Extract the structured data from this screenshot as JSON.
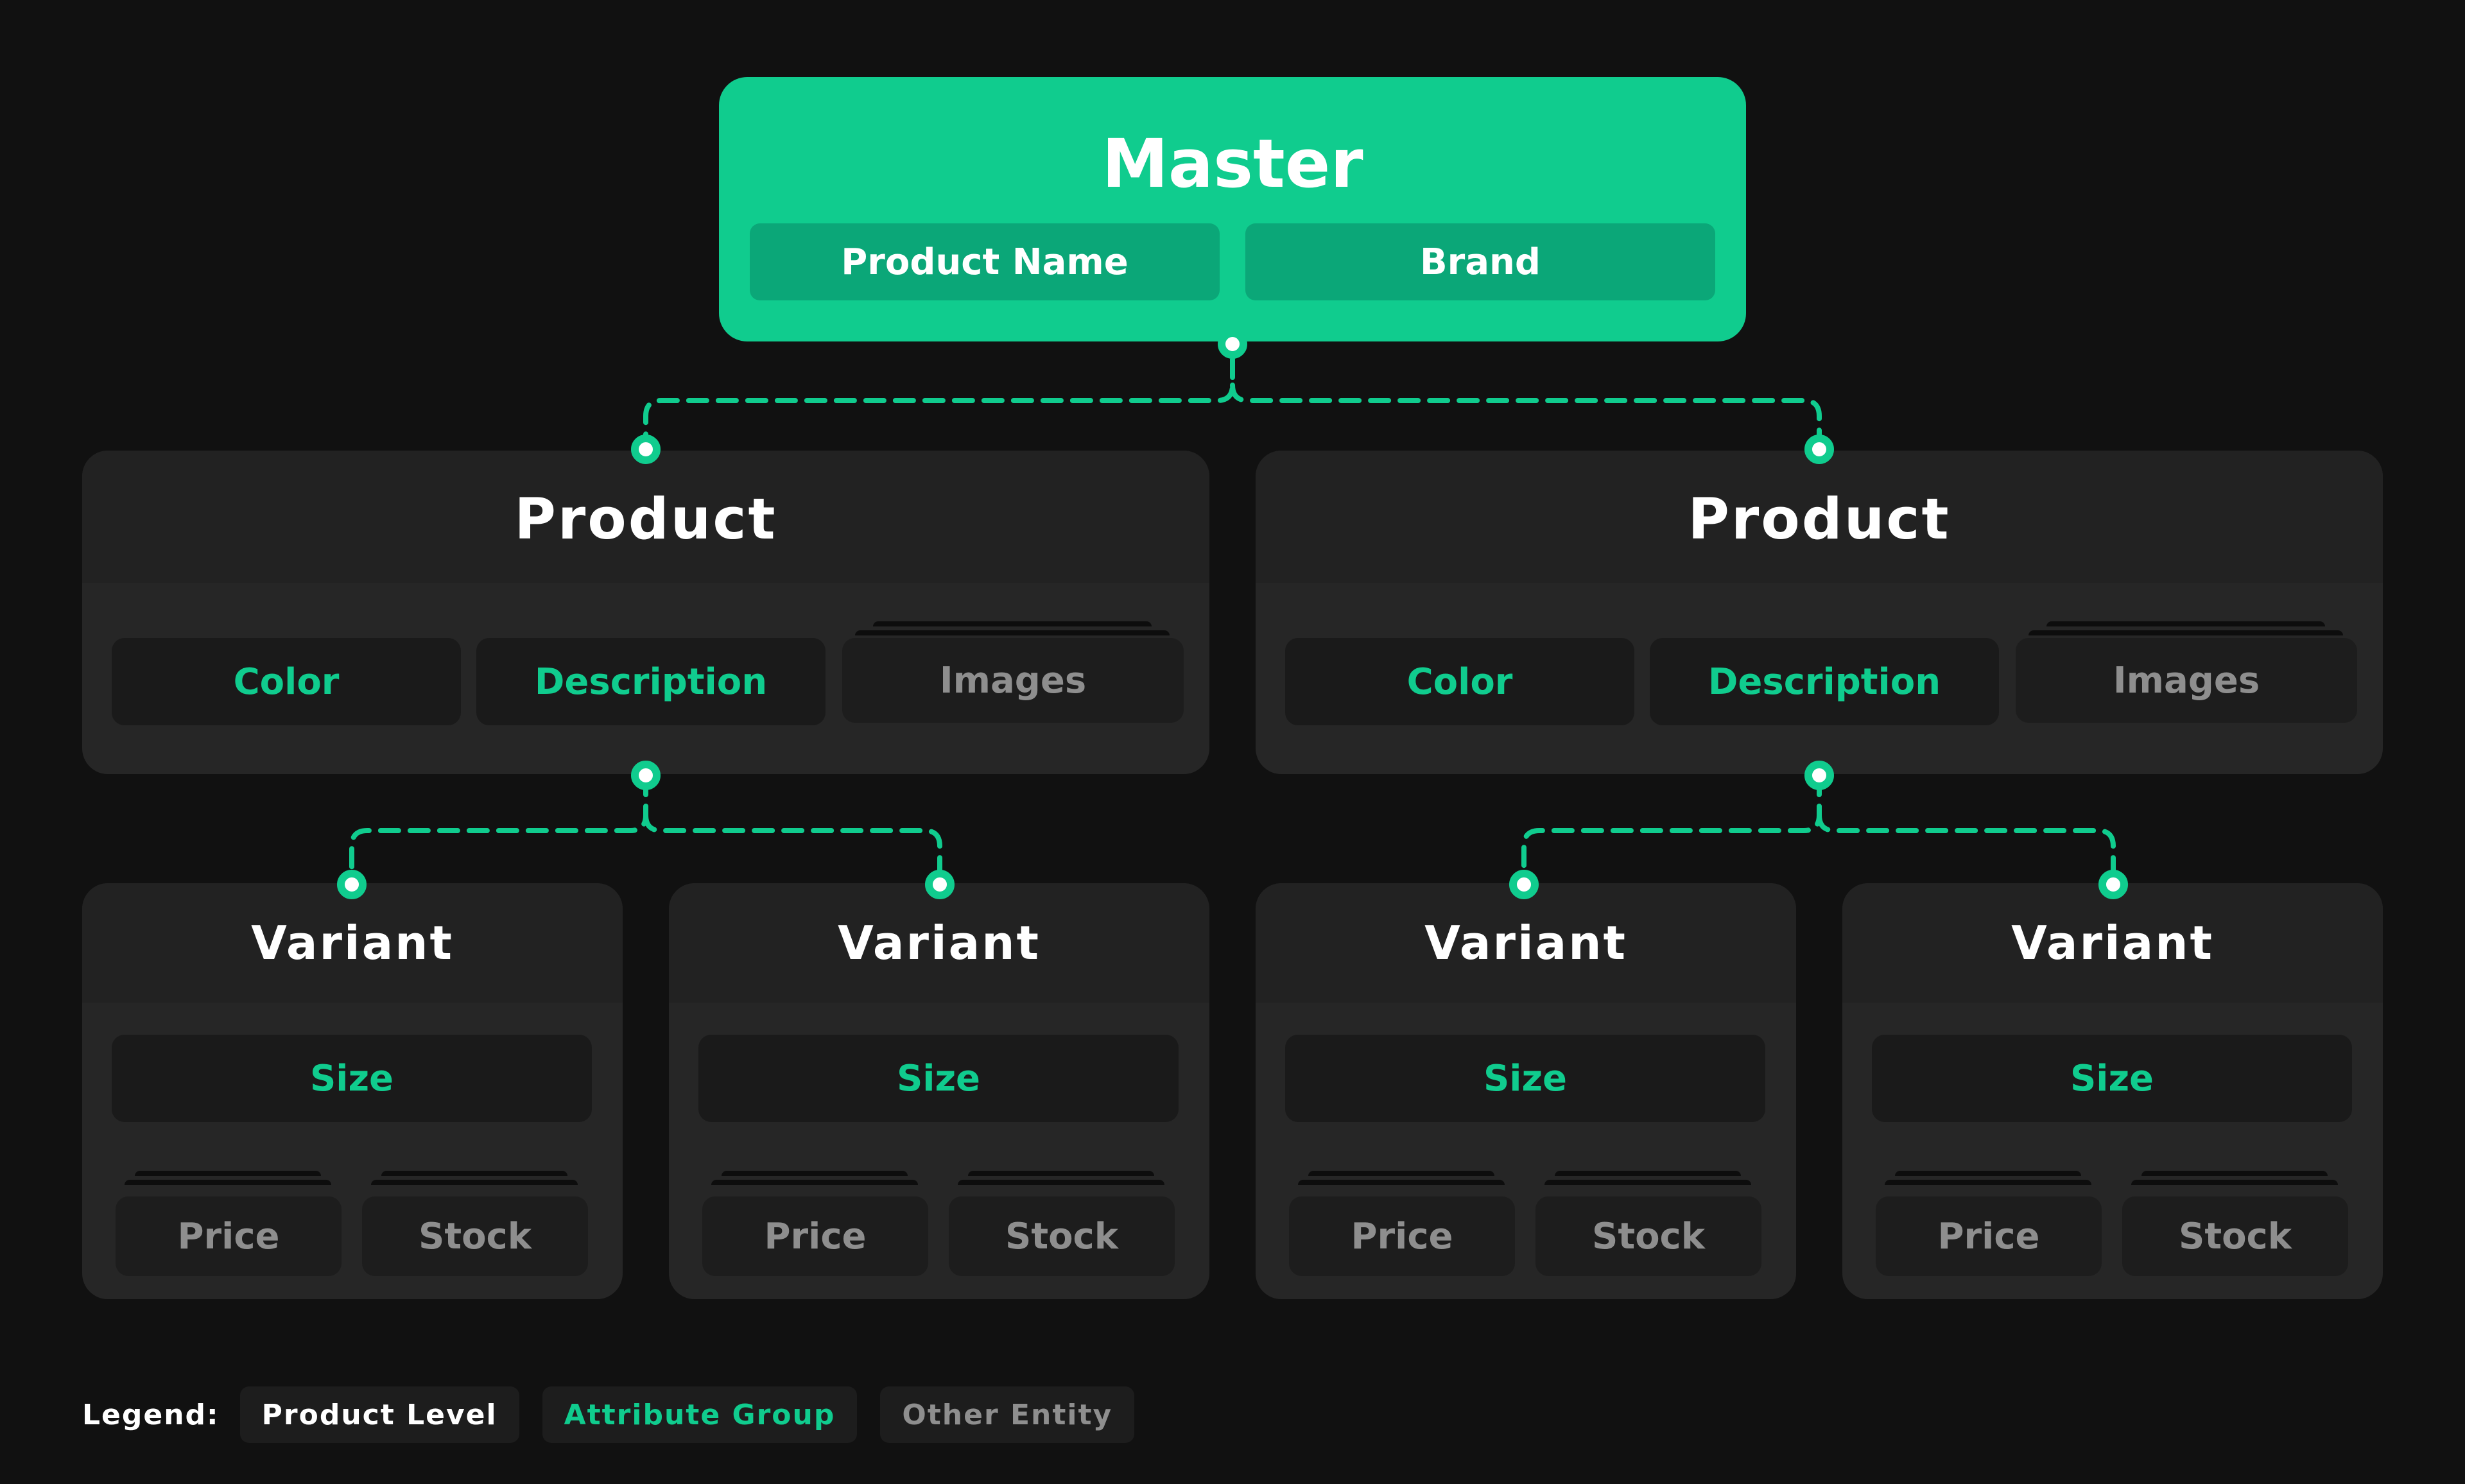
{
  "master": {
    "title": "Master",
    "attributes": [
      "Product Name",
      "Brand"
    ]
  },
  "products": [
    {
      "title": "Product",
      "attributes": [
        "Color",
        "Description"
      ],
      "other": "Images",
      "variants": [
        {
          "title": "Variant",
          "attribute": "Size",
          "others": [
            "Price",
            "Stock"
          ]
        },
        {
          "title": "Variant",
          "attribute": "Size",
          "others": [
            "Price",
            "Stock"
          ]
        }
      ]
    },
    {
      "title": "Product",
      "attributes": [
        "Color",
        "Description"
      ],
      "other": "Images",
      "variants": [
        {
          "title": "Variant",
          "attribute": "Size",
          "others": [
            "Price",
            "Stock"
          ]
        },
        {
          "title": "Variant",
          "attribute": "Size",
          "others": [
            "Price",
            "Stock"
          ]
        }
      ]
    }
  ],
  "legend": {
    "label": "Legend:",
    "items": [
      {
        "label": "Product Level",
        "color": "#ffffff"
      },
      {
        "label": "Attribute Group",
        "color": "#10cc8e"
      },
      {
        "label": "Other Entity",
        "color": "#8e8e8e"
      }
    ]
  },
  "colors": {
    "accent": "#10cc8e",
    "background": "#111111",
    "card": "#262626",
    "chip": "#1a1a1a"
  }
}
